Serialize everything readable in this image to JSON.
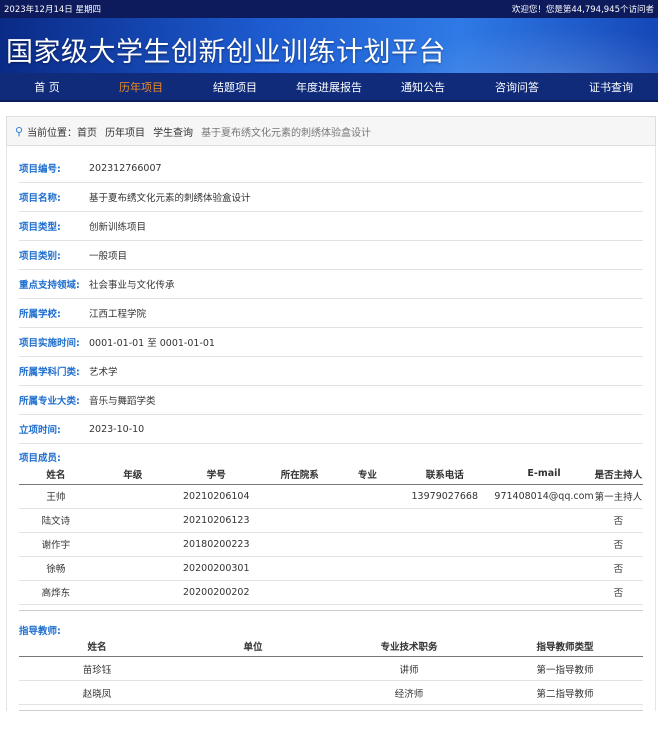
{
  "topbar": {
    "date": "2023年12月14日 星期四",
    "welcome": "欢迎您！您是第44,794,945个访问者"
  },
  "banner": {
    "title": "国家级大学生创新创业训练计划平台"
  },
  "nav": [
    {
      "label": "首 页",
      "active": false
    },
    {
      "label": "历年项目",
      "active": true
    },
    {
      "label": "结题项目",
      "active": false
    },
    {
      "label": "年度进展报告",
      "active": false
    },
    {
      "label": "通知公告",
      "active": false
    },
    {
      "label": "咨询问答",
      "active": false
    },
    {
      "label": "证书查询",
      "active": false
    }
  ],
  "breadcrumb": {
    "prefix": "当前位置：首页",
    "items": [
      "历年项目",
      "学生查询"
    ],
    "current": "基于夏布绣文化元素的刺绣体验盒设计"
  },
  "fields": [
    {
      "label": "项目编号:",
      "value": "202312766007"
    },
    {
      "label": "项目名称:",
      "value": "基于夏布绣文化元素的刺绣体验盒设计"
    },
    {
      "label": "项目类型:",
      "value": "创新训练项目"
    },
    {
      "label": "项目类别:",
      "value": "一般项目"
    },
    {
      "label": "重点支持领域:",
      "value": "社会事业与文化传承"
    },
    {
      "label": "所属学校:",
      "value": "江西工程学院"
    },
    {
      "label": "项目实施时间:",
      "value": "0001-01-01 至 0001-01-01"
    },
    {
      "label": "所属学科门类:",
      "value": "艺术学"
    },
    {
      "label": "所属专业大类:",
      "value": "音乐与舞蹈学类"
    },
    {
      "label": "立项时间:",
      "value": "2023-10-10"
    }
  ],
  "members": {
    "label": "项目成员:",
    "headers": [
      "姓名",
      "年级",
      "学号",
      "所在院系",
      "专业",
      "联系电话",
      "E-mail",
      "是否主持人"
    ],
    "rows": [
      [
        "王帅",
        "",
        "20210206104",
        "",
        "",
        "13979027668",
        "971408014@qq.com",
        "第一主持人"
      ],
      [
        "陆文诗",
        "",
        "20210206123",
        "",
        "",
        "",
        "",
        "否"
      ],
      [
        "谢作宇",
        "",
        "20180200223",
        "",
        "",
        "",
        "",
        "否"
      ],
      [
        "徐畅",
        "",
        "20200200301",
        "",
        "",
        "",
        "",
        "否"
      ],
      [
        "高烨东",
        "",
        "20200200202",
        "",
        "",
        "",
        "",
        "否"
      ]
    ]
  },
  "advisors": {
    "label": "指导教师:",
    "headers": [
      "姓名",
      "单位",
      "专业技术职务",
      "指导教师类型"
    ],
    "rows": [
      [
        "苗珍钰",
        "",
        "讲师",
        "第一指导教师"
      ],
      [
        "赵晓凤",
        "",
        "经济师",
        "第二指导教师"
      ]
    ]
  }
}
